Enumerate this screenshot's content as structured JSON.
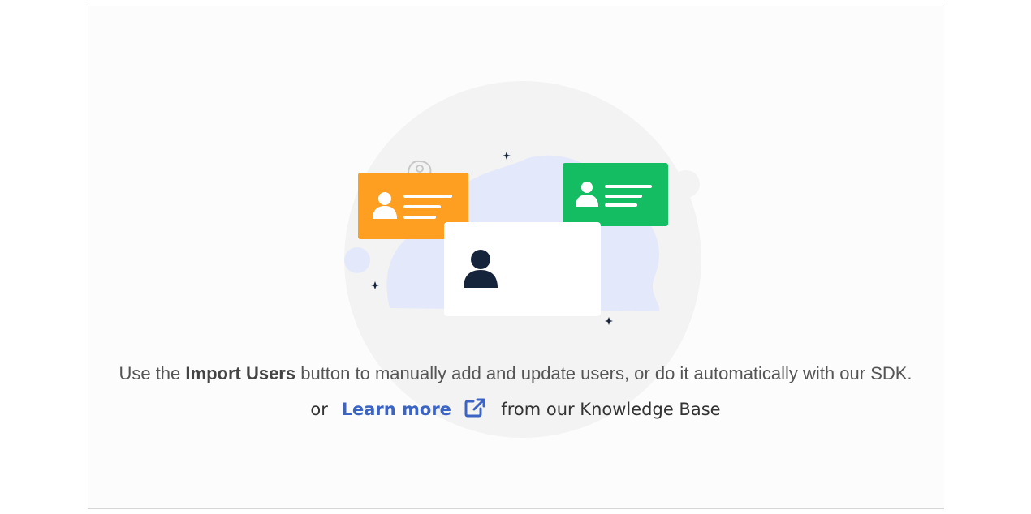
{
  "empty_state": {
    "message_prefix": "Use the ",
    "message_bold": "Import Users",
    "message_suffix": " button to manually add and update users, or do it automatically with our SDK.",
    "or_text": "or",
    "learn_more_label": "Learn more",
    "knowledge_base_text": "from our Knowledge Base"
  },
  "icons": {
    "external_link": "external-link-icon",
    "illustration": "user-cards-illustration"
  },
  "colors": {
    "link": "#3b64c4",
    "orange_card": "#ff9f22",
    "green_card": "#14bd62",
    "avatar_dark": "#16243b",
    "blob": "#e3e9fb",
    "circle": "#f3f3f3"
  }
}
